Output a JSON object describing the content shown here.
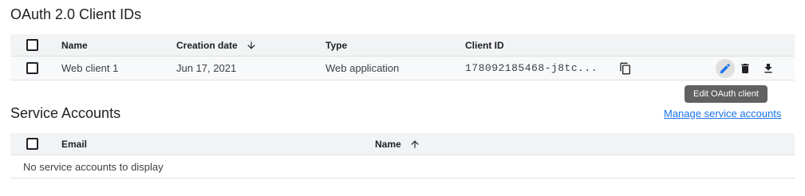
{
  "oauth": {
    "title": "OAuth 2.0 Client IDs",
    "headers": {
      "name": "Name",
      "creation_date": "Creation date",
      "type": "Type",
      "client_id": "Client ID"
    },
    "rows": [
      {
        "name": "Web client 1",
        "creation_date": "Jun 17, 2021",
        "type": "Web application",
        "client_id": "178092185468-j8tc..."
      }
    ],
    "tooltip": "Edit OAuth client"
  },
  "service_accounts": {
    "title": "Service Accounts",
    "manage_link": "Manage service accounts",
    "headers": {
      "email": "Email",
      "name": "Name"
    },
    "empty_text": "No service accounts to display"
  },
  "icons": {
    "copy": "copy-icon",
    "edit": "edit-pencil-icon",
    "delete": "trash-icon",
    "download": "download-icon",
    "sort_down": "arrow-down-icon",
    "sort_up": "arrow-up-icon"
  },
  "colors": {
    "accent": "#1a73e8",
    "text": "#202124",
    "header_bg": "#f1f3f4",
    "row_bg": "#f8f9fa"
  }
}
